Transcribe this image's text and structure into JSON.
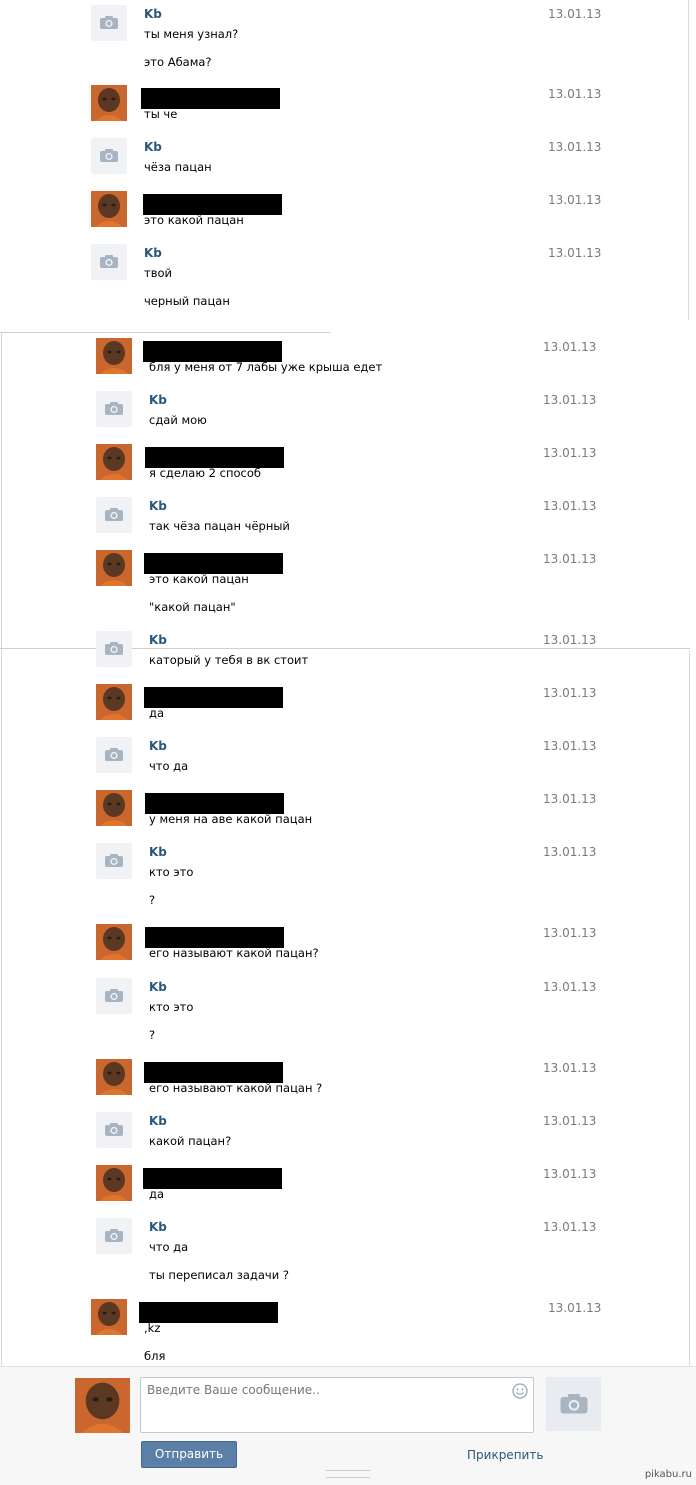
{
  "messages": [
    {
      "author": "Kb",
      "date": "13.01.13",
      "lines": [
        "ты меня узнал?",
        "это Абама?"
      ]
    },
    {
      "author": "",
      "date": "13.01.13",
      "lines": [
        "ты че"
      ]
    },
    {
      "author": "Kb",
      "date": "13.01.13",
      "lines": [
        "чёза пацан"
      ]
    },
    {
      "author": "",
      "date": "13.01.13",
      "lines": [
        "это какой пацан"
      ]
    },
    {
      "author": "Kb",
      "date": "13.01.13",
      "lines": [
        "твой",
        "черный пацан"
      ]
    },
    {
      "author": "",
      "date": "13.01.13",
      "lines": [
        "бля у меня от 7 лабы уже крыша едет"
      ]
    },
    {
      "author": "Kb",
      "date": "13.01.13",
      "lines": [
        "сдай мою"
      ]
    },
    {
      "author": "",
      "date": "13.01.13",
      "lines": [
        "я сделаю 2 способ"
      ]
    },
    {
      "author": "Kb",
      "date": "13.01.13",
      "lines": [
        "так чёза пацан чёрный"
      ]
    },
    {
      "author": "",
      "date": "13.01.13",
      "lines": [
        "это какой пацан",
        "\"какой пацан\""
      ]
    },
    {
      "author": "Kb",
      "date": "13.01.13",
      "lines": [
        "каторый у тебя в вк стоит"
      ]
    },
    {
      "author": "",
      "date": "13.01.13",
      "lines": [
        "да"
      ]
    },
    {
      "author": "Kb",
      "date": "13.01.13",
      "lines": [
        "что да"
      ]
    },
    {
      "author": "",
      "date": "13.01.13",
      "lines": [
        "у меня на аве какой пацан"
      ]
    },
    {
      "author": "Kb",
      "date": "13.01.13",
      "lines": [
        "кто это",
        "?"
      ]
    },
    {
      "author": "",
      "date": "13.01.13",
      "lines": [
        "его называют какой пацан?"
      ]
    },
    {
      "author": "Kb",
      "date": "13.01.13",
      "lines": [
        "кто это",
        "?"
      ]
    },
    {
      "author": "",
      "date": "13.01.13",
      "lines": [
        "его называют какой пацан ?"
      ]
    },
    {
      "author": "Kb",
      "date": "13.01.13",
      "lines": [
        "какой пацан?"
      ]
    },
    {
      "author": "",
      "date": "13.01.13",
      "lines": [
        "да"
      ]
    },
    {
      "author": "Kb",
      "date": "13.01.13",
      "lines": [
        "что да",
        "ты переписал задачи ?"
      ]
    },
    {
      "author": "",
      "date": "13.01.13",
      "lines": [
        ",kz",
        "бля"
      ]
    }
  ],
  "composer": {
    "placeholder": "Введите Ваше сообщение..",
    "send_label": "Отправить",
    "attach_label": "Прикрепить"
  },
  "watermark": "pikabu.ru",
  "colors": {
    "name": "#2b587a",
    "button": "#5b7fa6",
    "date": "#7a7a7a"
  }
}
